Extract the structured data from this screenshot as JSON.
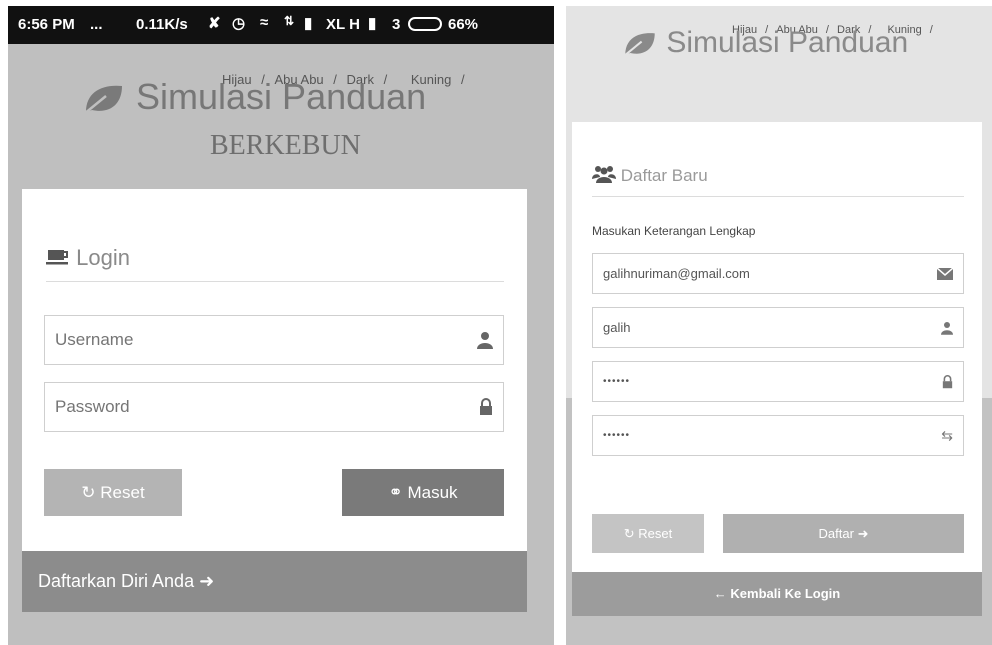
{
  "left_screen": {
    "status_bar": {
      "time": "6:56 PM",
      "dots": "...",
      "speed": "0.11K/s",
      "carrier": "XL H",
      "sim2": "3",
      "battery": "66%"
    },
    "theme_links": [
      "Hijau",
      "Abu Abu",
      "Dark",
      "Kuning"
    ],
    "theme_separator": "/",
    "brand_title": "Simulasi Panduan",
    "brand_subtitle": "BERKEBUN",
    "login_title": "Login",
    "username_placeholder": "Username",
    "password_placeholder": "Password",
    "reset_label": "Reset",
    "submit_label": "Masuk",
    "register_link": "Daftarkan Diri Anda"
  },
  "right_screen": {
    "theme_links": [
      "Hijau",
      "Abu Abu",
      "Dark",
      "Kuning"
    ],
    "theme_separator": "/",
    "brand_title": "Simulasi Panduan",
    "register_title": "Daftar Baru",
    "instructions": "Masukan Keterangan Lengkap",
    "email_value": "galihnuriman@gmail.com",
    "username_value": "galih",
    "password_value": "••••••",
    "password_confirm_value": "••••••",
    "reset_label": "Reset",
    "submit_label": "Daftar",
    "back_link": "Kembali Ke Login"
  },
  "icons": {
    "leaf": "leaf-icon",
    "coffee": "coffee-icon",
    "user": "user-icon",
    "lock": "lock-icon",
    "refresh": "refresh-icon",
    "key": "key-icon",
    "arrow_right": "arrow-right-icon",
    "arrow_left": "arrow-left-icon",
    "users": "users-icon",
    "envelope": "envelope-icon",
    "retweet": "retweet-icon"
  },
  "colors": {
    "background": "#bfbfbf",
    "card": "#ffffff",
    "button_dark": "#7a7a7a",
    "button_light": "#b4b4b4",
    "bar": "#8c8c8c",
    "status_bar": "#111111"
  }
}
